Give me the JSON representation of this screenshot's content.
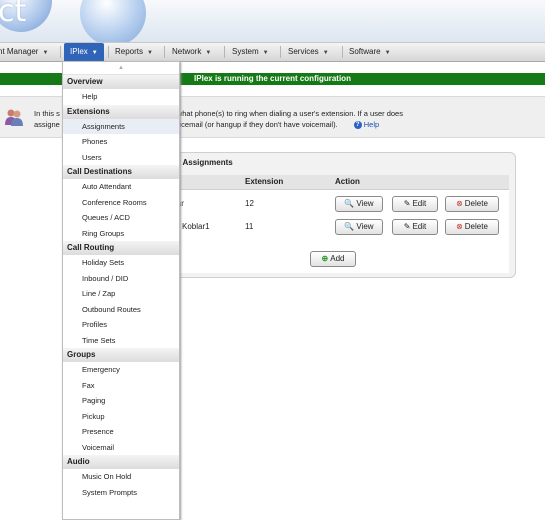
{
  "header": {
    "logo_text": "ct"
  },
  "nav": [
    {
      "label": "nt Manager",
      "active": false
    },
    {
      "label": "IPlex",
      "active": true
    },
    {
      "label": "Reports",
      "active": false
    },
    {
      "label": "Network",
      "active": false
    },
    {
      "label": "System",
      "active": false
    },
    {
      "label": "Services",
      "active": false
    },
    {
      "label": "Software",
      "active": false
    }
  ],
  "status": {
    "text": "IPlex is running the current configuration",
    "color": "#157a15"
  },
  "info": {
    "line1": "In this s                              nes to users. This tells the system what phone(s) to ring when dialing a user's extension. If a user does",
    "line2": "assigne                                 sion will take you directly to their voicemail (or hangup if they don't have voicemail).",
    "help_label": "Help"
  },
  "panel": {
    "title": "nt Assignments",
    "columns": {
      "extension": "Extension",
      "action": "Action"
    },
    "rows": [
      {
        "name": "lar",
        "extension": "12"
      },
      {
        "name": "Koblar1",
        "extension": "11"
      }
    ],
    "buttons": {
      "view": "View",
      "edit": "Edit",
      "delete": "Delete",
      "add": "Add"
    }
  },
  "menu": {
    "groups": [
      {
        "title": "Overview",
        "items": [
          "Help"
        ]
      },
      {
        "title": "Extensions",
        "items": [
          "Assignments",
          "Phones",
          "Users"
        ]
      },
      {
        "title": "Call Destinations",
        "items": [
          "Auto Attendant",
          "Conference Rooms",
          "Queues / ACD",
          "Ring Groups"
        ]
      },
      {
        "title": "Call Routing",
        "items": [
          "Holiday Sets",
          "Inbound / DID",
          "Line / Zap",
          "Outbound Routes",
          "Profiles",
          "Time Sets"
        ]
      },
      {
        "title": "Groups",
        "items": [
          "Emergency",
          "Fax",
          "Paging",
          "Pickup",
          "Presence",
          "Voicemail"
        ]
      },
      {
        "title": "Audio",
        "items": [
          "Music On Hold",
          "System Prompts"
        ]
      }
    ]
  }
}
